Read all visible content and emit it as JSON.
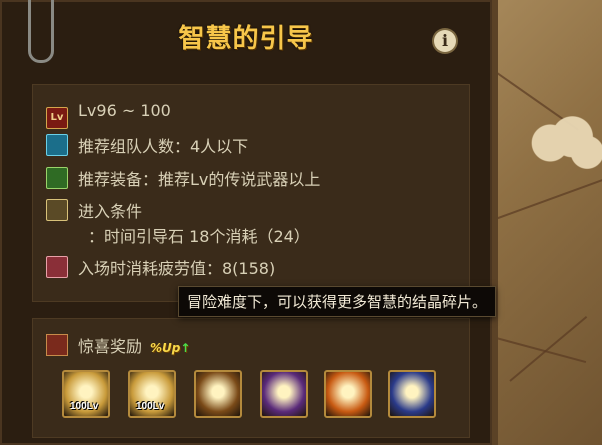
{
  "title": "智慧的引导",
  "info_icon_glyph": "i",
  "info": {
    "level": {
      "icon": "lv-icon",
      "icon_text": "Lv",
      "text": "Lv96 ~ 100"
    },
    "party": {
      "icon": "party-icon",
      "text": "推荐组队人数：4人以下"
    },
    "equipment": {
      "icon": "sword-icon",
      "text": "推荐装备：推荐Lv的传说武器以上"
    },
    "entry": {
      "icon": "key-icon",
      "text": "进入条件",
      "detail": "：时间引导石 18个消耗（24）"
    },
    "fatigue": {
      "icon": "fatigue-icon",
      "text": "入场时消耗疲劳值：8(158)"
    }
  },
  "tooltip": "冒险难度下，可以获得更多智慧的结晶碎片。",
  "reward": {
    "label": "惊喜奖励",
    "badge": "%Up",
    "badge_arrow": "↑",
    "items": [
      {
        "name": "weapon-box-100lv",
        "lv_text": "100Lv",
        "color": "#c89a3a"
      },
      {
        "name": "weapon-box-100lv",
        "lv_text": "100Lv",
        "color": "#c89a3a"
      },
      {
        "name": "green-orb",
        "lv_text": "",
        "color": "#7a4a18"
      },
      {
        "name": "purple-egg",
        "lv_text": "",
        "color": "#5a2a7a"
      },
      {
        "name": "fire-gem",
        "lv_text": "",
        "color": "#c85a12"
      },
      {
        "name": "blue-orb",
        "lv_text": "",
        "color": "#2a3a8a"
      }
    ]
  }
}
